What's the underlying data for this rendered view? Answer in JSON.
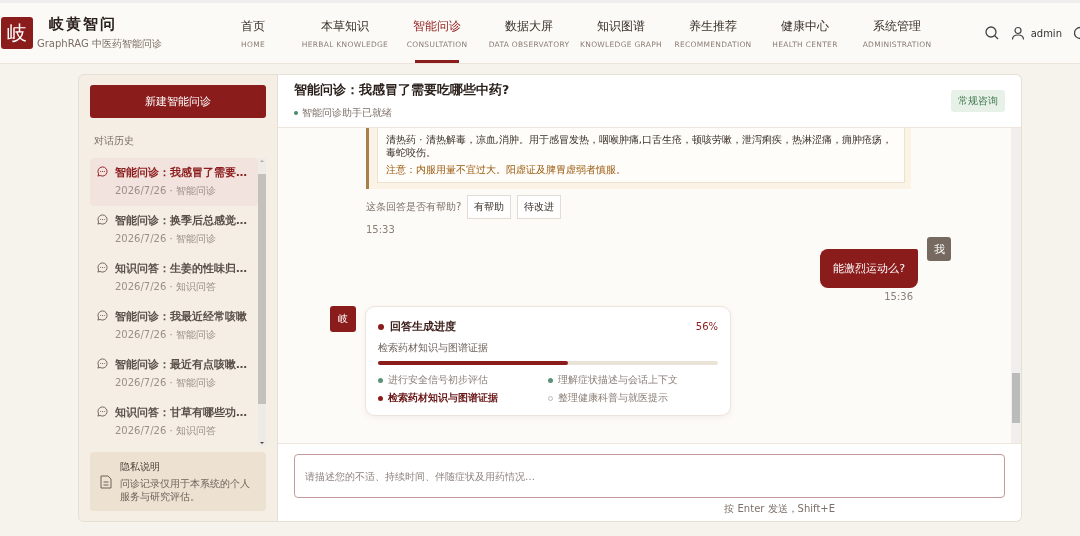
{
  "brand": {
    "logo": "岐",
    "name": "岐黄智问",
    "subtitle": "GraphRAG 中医药智能问诊"
  },
  "nav": [
    {
      "label": "首页",
      "sub": "HOME",
      "selected": false
    },
    {
      "label": "本草知识",
      "sub": "HERBAL KNOWLEDGE",
      "selected": false
    },
    {
      "label": "智能问诊",
      "sub": "CONSULTATION",
      "selected": true
    },
    {
      "label": "数据大屏",
      "sub": "DATA OBSERVATORY",
      "selected": false
    },
    {
      "label": "知识图谱",
      "sub": "KNOWLEDGE GRAPH",
      "selected": false
    },
    {
      "label": "养生推荐",
      "sub": "RECOMMENDATION",
      "selected": false
    },
    {
      "label": "健康中心",
      "sub": "HEALTH CENTER",
      "selected": false
    },
    {
      "label": "系统管理",
      "sub": "ADMINISTRATION",
      "selected": false
    }
  ],
  "user": {
    "name": "admin"
  },
  "sidebar": {
    "new_button": "新建智能问诊",
    "history_title": "对话历史",
    "items": [
      {
        "title": "智能问诊：我感冒了需要…",
        "meta": "2026/7/26 · 智能问诊",
        "selected": true
      },
      {
        "title": "智能问诊：换季后总感觉…",
        "meta": "2026/7/26 · 智能问诊",
        "selected": false
      },
      {
        "title": "知识问答：生姜的性味归…",
        "meta": "2026/7/26 · 知识问答",
        "selected": false
      },
      {
        "title": "智能问诊：我最近经常咳嗽",
        "meta": "2026/7/26 · 智能问诊",
        "selected": false
      },
      {
        "title": "智能问诊：最近有点咳嗽…",
        "meta": "2026/7/26 · 智能问诊",
        "selected": false
      },
      {
        "title": "知识问答：甘草有哪些功…",
        "meta": "2026/7/26 · 知识问答",
        "selected": false
      }
    ],
    "privacy": {
      "title": "隐私说明",
      "text": "问诊记录仅用于本系统的个人服务与研究评估。"
    }
  },
  "chat": {
    "title": "智能问诊：我感冒了需要吃哪些中药?",
    "status": "智能问诊助手已就绪",
    "tag": "常规咨询",
    "herb_card": {
      "desc": "清热药 · 清热解毒，凉血,消肿。用于感冒发热，咽喉肿痛,口舌生疮，顿咳劳嗽，泄泻痢疾，热淋涩痛，痈肿疮疡，毒蛇咬伤。",
      "caution": "注意：内服用量不宜过大。阳虚证及脾胃虚弱者慎服。"
    },
    "feedback": {
      "question": "这条回答是否有帮助?",
      "buttons": [
        "有帮助",
        "待改进"
      ]
    },
    "bot_time": "15:33",
    "user_message": {
      "avatar": "我",
      "text": "能激烈运动么?",
      "time": "15:36"
    },
    "bot_avatar": "岐",
    "progress": {
      "title": "回答生成进度",
      "percent": "56%",
      "current": "检索药材知识与图谱证据",
      "level": 0.56,
      "steps": [
        {
          "label": "进行安全信号初步评估",
          "done": true,
          "active": false
        },
        {
          "label": "理解症状描述与会话上下文",
          "done": true,
          "active": false
        },
        {
          "label": "检索药材知识与图谱证据",
          "done": false,
          "active": true
        },
        {
          "label": "整理健康科普与就医提示",
          "done": false,
          "active": false
        }
      ]
    },
    "input": {
      "placeholder": "请描述您的不适、持续时间、伴随症状及用药情况…",
      "hint": "按 Enter 发送，Shift+E"
    }
  }
}
